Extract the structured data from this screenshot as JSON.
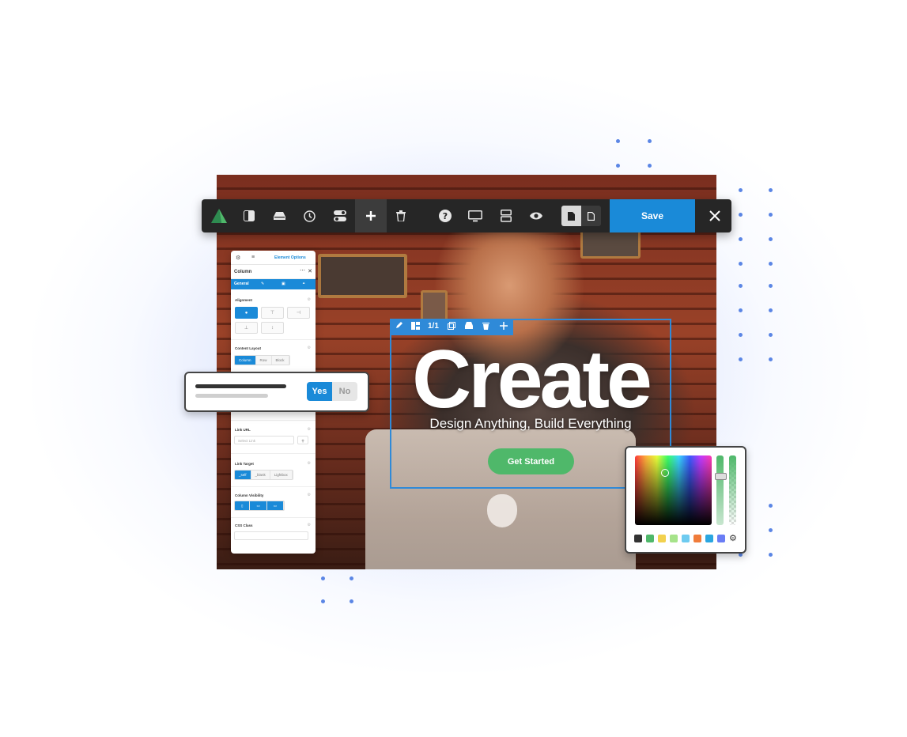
{
  "toolbar": {
    "save_label": "Save",
    "icons": [
      "logo-icon",
      "layout-icon",
      "stack-icon",
      "history-icon",
      "toggle-icon",
      "add-icon",
      "trash-icon",
      "help-icon",
      "desktop-icon",
      "sections-icon",
      "preview-icon",
      "page-icon",
      "page-blank-icon",
      "close-icon"
    ]
  },
  "panel": {
    "header_tab": "Element Options",
    "title": "Column",
    "tabs": [
      "General",
      "",
      "",
      ""
    ],
    "sections": {
      "alignment": "Alignment",
      "content_layout": "Content Layout",
      "link_url": "Link URL",
      "link_target": "Link Target",
      "column_visibility": "Column Visibility",
      "css_class": "CSS Class"
    },
    "content_layout_options": [
      "Column",
      "Row",
      "Block"
    ],
    "link_url_placeholder": "Select Link",
    "link_target_options": [
      "_self",
      "_blank",
      "Lightbox"
    ]
  },
  "yesno": {
    "yes": "Yes",
    "no": "No"
  },
  "selection_toolbar": {
    "counter": "1/1"
  },
  "hero": {
    "headline": "Create",
    "subtitle": "Design Anything, Build Everything",
    "cta": "Get Started"
  },
  "colors": {
    "accent": "#1a8ad8",
    "cta": "#4fb86a",
    "toolbar_bg": "#262626",
    "swatches": [
      "#333333",
      "#4fb86a",
      "#f2d14e",
      "#a6e38a",
      "#6ecbf0",
      "#f07c3a",
      "#2aa6e0",
      "#6a7df5"
    ]
  }
}
